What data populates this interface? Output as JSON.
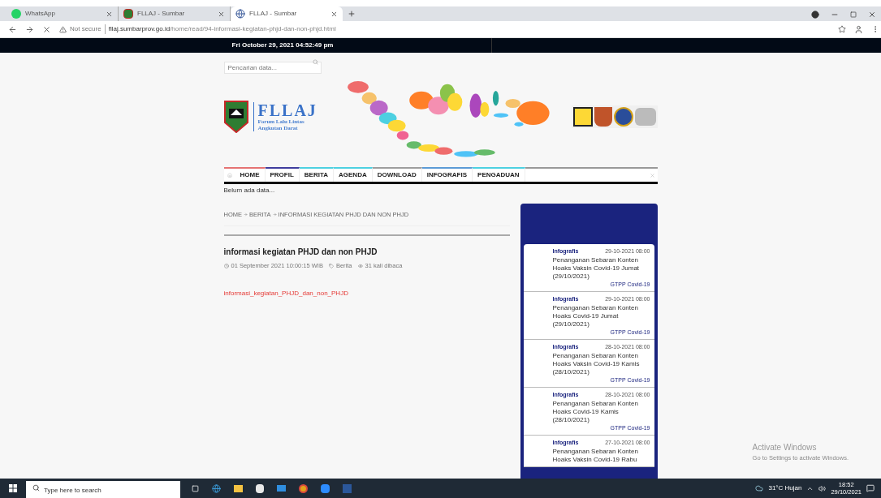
{
  "browser": {
    "tabs": [
      {
        "title": "WhatsApp",
        "selected": false
      },
      {
        "title": "FLLAJ - Sumbar",
        "selected": false
      },
      {
        "title": "FLLAJ - Sumbar",
        "selected": true
      }
    ],
    "address": {
      "security": "Not secure",
      "host": "fllaj.sumbarprov.go.id",
      "path": "/home/read/94-informasi-kegiatan-phjd-dan-non-phjd.html"
    }
  },
  "page": {
    "datetime": "Fri October 29, 2021 04:52:49 pm",
    "search": {
      "placeholder": "Pencarian data..."
    },
    "logo": {
      "title": "FLLAJ",
      "subtitle": [
        "Forum Lalu Lintas",
        "Angkutan Darat"
      ]
    },
    "nav": [
      {
        "label": "HOME",
        "color": "#e57373"
      },
      {
        "label": "PROFIL",
        "color": "#3f3d9e"
      },
      {
        "label": "BERITA",
        "color": "#4dd0e1"
      },
      {
        "label": "AGENDA",
        "color": "#4dd0e1"
      },
      {
        "label": "DOWNLOAD",
        "color": "#9e9e9e"
      },
      {
        "label": "INFOGRAFIS",
        "color": "#5c9bd6"
      },
      {
        "label": "PENGADUAN",
        "color": "#4dd0e1"
      }
    ],
    "ticker": "Belum ada data...",
    "breadcrumb": [
      "HOME",
      "BERITA",
      "INFORMASI KEGIATAN PHJD DAN NON PHJD"
    ],
    "article": {
      "title": "informasi kegiatan PHJD dan non PHJD",
      "date": "01 September 2021 10:00:15 WIB",
      "category": "Berita",
      "views": "31 kali dibaca",
      "attachment": "informasi_kegiatan_PHJD_dan_non_PHJD"
    },
    "sidebar": [
      {
        "category": "Infografis",
        "date": "29-10-2021 08:00",
        "title": "Penanganan Sebaran Konten Hoaks Vaksin Covid-19 Jumat (29/10/2021)",
        "source": "GTPP Covid-19"
      },
      {
        "category": "Infografis",
        "date": "29-10-2021 08:00",
        "title": "Penanganan Sebaran Konten Hoaks Covid-19 Jumat (29/10/2021)",
        "source": "GTPP Covid-19"
      },
      {
        "category": "Infografis",
        "date": "28-10-2021 08:00",
        "title": "Penanganan Sebaran Konten Hoaks Vaksin Covid-19 Kamis (28/10/2021)",
        "source": "GTPP Covid-19"
      },
      {
        "category": "Infografis",
        "date": "28-10-2021 08:00",
        "title": "Penanganan Sebaran Konten Hoaks Covid-19 Kamis (28/10/2021)",
        "source": "GTPP Covid-19"
      },
      {
        "category": "Infografis",
        "date": "27-10-2021 08:00",
        "title": "Penanganan Sebaran Konten Hoaks Vaksin Covid-19 Rabu"
      }
    ]
  },
  "activation": {
    "title": "Activate Windows",
    "text": "Go to Settings to activate Windows."
  },
  "taskbar": {
    "search": {
      "placeholder": "Type here to search"
    },
    "weather": "31°C Hujan",
    "time": "18:52",
    "date": "29/10/2021"
  }
}
